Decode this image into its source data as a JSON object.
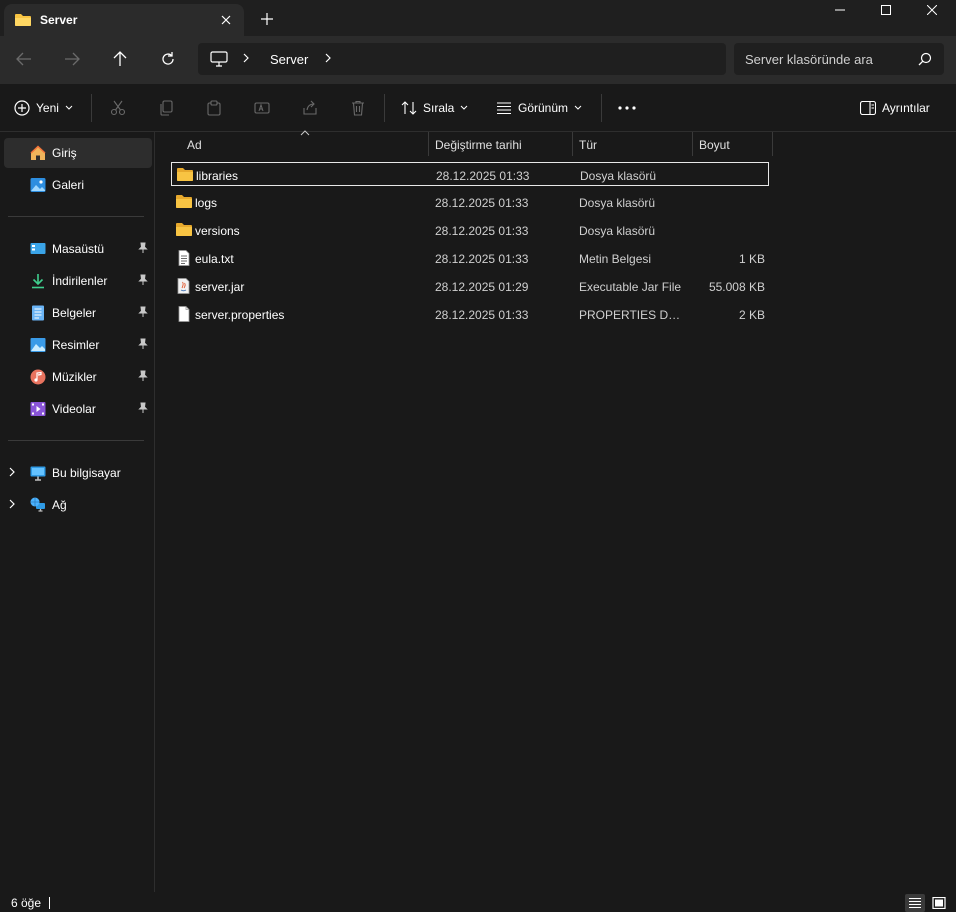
{
  "window": {
    "tab_title": "Server",
    "new_tab": "+"
  },
  "address": {
    "crumbs": [
      "Server"
    ],
    "search_placeholder": "Server klasöründe ara"
  },
  "toolbar": {
    "new_label": "Yeni",
    "sort_label": "Sırala",
    "view_label": "Görünüm",
    "details_label": "Ayrıntılar"
  },
  "sidebar": {
    "top": [
      {
        "label": "Giriş",
        "icon": "home-icon"
      },
      {
        "label": "Galeri",
        "icon": "gallery-icon"
      }
    ],
    "pinned": [
      {
        "label": "Masaüstü",
        "icon": "desktop-icon"
      },
      {
        "label": "İndirilenler",
        "icon": "download-icon"
      },
      {
        "label": "Belgeler",
        "icon": "documents-icon"
      },
      {
        "label": "Resimler",
        "icon": "pictures-icon"
      },
      {
        "label": "Müzikler",
        "icon": "music-icon"
      },
      {
        "label": "Videolar",
        "icon": "videos-icon"
      }
    ],
    "devices": [
      {
        "label": "Bu bilgisayar",
        "icon": "this-pc-icon"
      },
      {
        "label": "Ağ",
        "icon": "network-icon"
      }
    ]
  },
  "columns": {
    "name": "Ad",
    "date": "Değiştirme tarihi",
    "type": "Tür",
    "size": "Boyut"
  },
  "files": [
    {
      "name": "libraries",
      "date": "28.12.2025 01:33",
      "type": "Dosya klasörü",
      "size": "",
      "icon": "folder-icon"
    },
    {
      "name": "logs",
      "date": "28.12.2025 01:33",
      "type": "Dosya klasörü",
      "size": "",
      "icon": "folder-icon"
    },
    {
      "name": "versions",
      "date": "28.12.2025 01:33",
      "type": "Dosya klasörü",
      "size": "",
      "icon": "folder-icon"
    },
    {
      "name": "eula.txt",
      "date": "28.12.2025 01:33",
      "type": "Metin Belgesi",
      "size": "1 KB",
      "icon": "text-file-icon"
    },
    {
      "name": "server.jar",
      "date": "28.12.2025 01:29",
      "type": "Executable Jar File",
      "size": "55.008 KB",
      "icon": "jar-file-icon"
    },
    {
      "name": "server.properties",
      "date": "28.12.2025 01:33",
      "type": "PROPERTIES Dosy...",
      "size": "2 KB",
      "icon": "file-icon"
    }
  ],
  "status": {
    "item_count": "6 öğe"
  },
  "colors": {
    "background": "#191919",
    "chrome": "#2b2b2b",
    "folder": "#f8c443",
    "accent": "#4cc2ff"
  }
}
